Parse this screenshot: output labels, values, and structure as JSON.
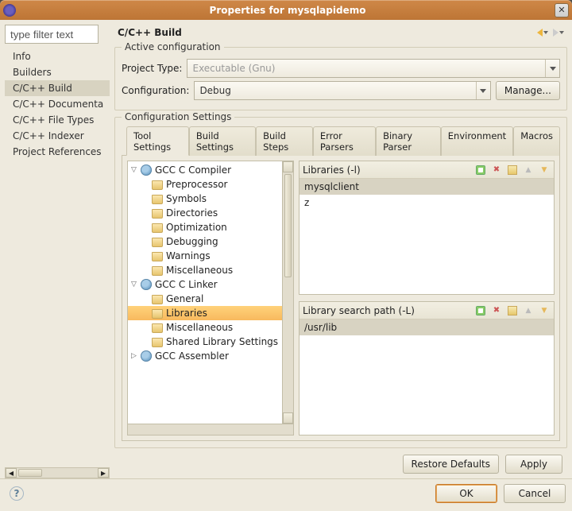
{
  "window": {
    "title": "Properties for mysqlapidemo"
  },
  "filter_placeholder": "type filter text",
  "nav": {
    "items": [
      {
        "label": "Info"
      },
      {
        "label": "Builders"
      },
      {
        "label": "C/C++ Build"
      },
      {
        "label": "C/C++ Documenta"
      },
      {
        "label": "C/C++ File Types"
      },
      {
        "label": "C/C++ Indexer"
      },
      {
        "label": "Project References"
      }
    ],
    "selected_index": 2
  },
  "heading": "C/C++ Build",
  "active_config": {
    "legend": "Active configuration",
    "project_type_label": "Project Type:",
    "project_type_value": "Executable (Gnu)",
    "configuration_label": "Configuration:",
    "configuration_value": "Debug",
    "manage_btn": "Manage..."
  },
  "config_settings": {
    "legend": "Configuration Settings",
    "tabs": [
      "Tool Settings",
      "Build Settings",
      "Build Steps",
      "Error Parsers",
      "Binary Parser",
      "Environment",
      "Macros"
    ],
    "selected_tab": 0,
    "tree": [
      {
        "level": 1,
        "expand": "▽",
        "icon": "cog",
        "label": "GCC C Compiler"
      },
      {
        "level": 2,
        "icon": "folder",
        "label": "Preprocessor"
      },
      {
        "level": 2,
        "icon": "folder",
        "label": "Symbols"
      },
      {
        "level": 2,
        "icon": "folder",
        "label": "Directories"
      },
      {
        "level": 2,
        "icon": "folder",
        "label": "Optimization"
      },
      {
        "level": 2,
        "icon": "folder",
        "label": "Debugging"
      },
      {
        "level": 2,
        "icon": "folder",
        "label": "Warnings"
      },
      {
        "level": 2,
        "icon": "folder",
        "label": "Miscellaneous"
      },
      {
        "level": 1,
        "expand": "▽",
        "icon": "cog",
        "label": "GCC C Linker"
      },
      {
        "level": 2,
        "icon": "folder",
        "label": "General"
      },
      {
        "level": 2,
        "icon": "folder",
        "label": "Libraries",
        "selected": true
      },
      {
        "level": 2,
        "icon": "folder",
        "label": "Miscellaneous"
      },
      {
        "level": 2,
        "icon": "folder",
        "label": "Shared Library Settings"
      },
      {
        "level": 1,
        "expand": "▷",
        "icon": "cog",
        "label": "GCC Assembler"
      }
    ],
    "libraries_panel": {
      "title": "Libraries (-l)",
      "items": [
        "mysqlclient",
        "z"
      ],
      "selected_index": 0
    },
    "libpath_panel": {
      "title": "Library search path (-L)",
      "items": [
        "/usr/lib"
      ],
      "selected_index": 0
    }
  },
  "footer": {
    "restore": "Restore Defaults",
    "apply": "Apply",
    "ok": "OK",
    "cancel": "Cancel"
  }
}
